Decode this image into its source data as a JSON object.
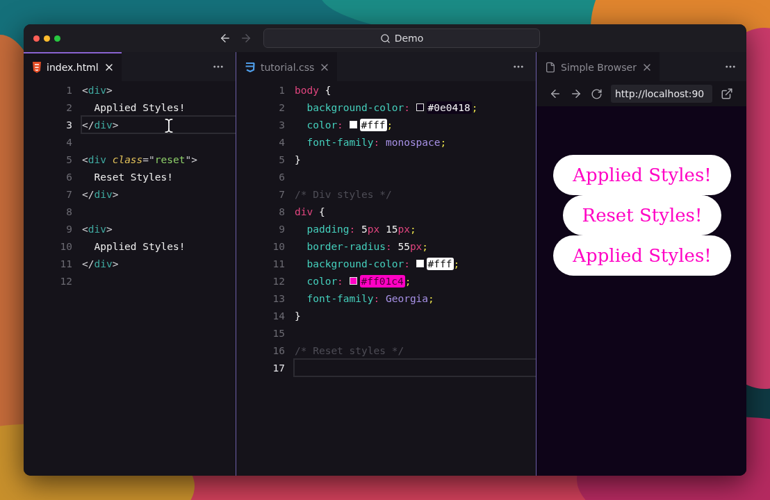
{
  "window": {
    "search": "Demo"
  },
  "panes": [
    {
      "kind": "code",
      "tab": {
        "label": "index.html",
        "selected": true
      },
      "lines": [
        {
          "number": "1",
          "current": false,
          "tokens": [
            {
              "kind": "bracket",
              "text": "<"
            },
            {
              "kind": "tag",
              "text": "div"
            },
            {
              "kind": "bracket",
              "text": ">"
            }
          ]
        },
        {
          "number": "2",
          "current": false,
          "tokens": [
            {
              "kind": "text",
              "text": "  Applied Styles!"
            }
          ]
        },
        {
          "number": "3",
          "current": true,
          "tokens": [
            {
              "kind": "bracket",
              "text": "</"
            },
            {
              "kind": "tag",
              "text": "div"
            },
            {
              "kind": "bracket",
              "text": ">"
            }
          ]
        },
        {
          "number": "4",
          "current": false
        },
        {
          "number": "5",
          "current": false,
          "tokens": [
            {
              "kind": "bracket",
              "text": "<"
            },
            {
              "kind": "tag",
              "text": "div"
            },
            {
              "kind": "attr",
              "text": " class"
            },
            {
              "kind": "punct",
              "text": "=\""
            },
            {
              "kind": "string",
              "text": "reset"
            },
            {
              "kind": "punct",
              "text": "\""
            },
            {
              "kind": "bracket",
              "text": ">"
            }
          ]
        },
        {
          "number": "6",
          "current": false,
          "tokens": [
            {
              "kind": "text",
              "text": "  Reset Styles!"
            }
          ]
        },
        {
          "number": "7",
          "current": false,
          "tokens": [
            {
              "kind": "bracket",
              "text": "</"
            },
            {
              "kind": "tag",
              "text": "div"
            },
            {
              "kind": "bracket",
              "text": ">"
            }
          ]
        },
        {
          "number": "8",
          "current": false
        },
        {
          "number": "9",
          "current": false,
          "tokens": [
            {
              "kind": "bracket",
              "text": "<"
            },
            {
              "kind": "tag",
              "text": "div"
            },
            {
              "kind": "bracket",
              "text": ">"
            }
          ]
        },
        {
          "number": "10",
          "current": false,
          "tokens": [
            {
              "kind": "text",
              "text": "  Applied Styles!"
            }
          ]
        },
        {
          "number": "11",
          "current": false,
          "tokens": [
            {
              "kind": "bracket",
              "text": "</"
            },
            {
              "kind": "tag",
              "text": "div"
            },
            {
              "kind": "bracket",
              "text": ">"
            }
          ]
        },
        {
          "number": "12",
          "current": false
        }
      ]
    },
    {
      "kind": "code",
      "tab": {
        "label": "tutorial.css",
        "selected": false
      },
      "lines": [
        {
          "number": "1",
          "current": false,
          "tokens": [
            {
              "kind": "selector",
              "text": "body"
            },
            {
              "kind": "brace",
              "text": " {"
            }
          ]
        },
        {
          "number": "2",
          "current": false,
          "tokens": [
            {
              "kind": "property",
              "text": "  background-color"
            },
            {
              "kind": "colon",
              "text": ": "
            },
            {
              "kind": "swatch",
              "color": "#0e0418"
            },
            {
              "kind": "hex",
              "text": "#0e0418",
              "color": "#0e0418"
            },
            {
              "kind": "semicolon",
              "text": ";"
            }
          ]
        },
        {
          "number": "3",
          "current": false,
          "tokens": [
            {
              "kind": "property",
              "text": "  color"
            },
            {
              "kind": "colon",
              "text": ": "
            },
            {
              "kind": "swatch",
              "color": "#ffffff"
            },
            {
              "kind": "hex",
              "text": "#fff",
              "color": "#ffffff"
            },
            {
              "kind": "semicolon",
              "text": ";"
            }
          ]
        },
        {
          "number": "4",
          "current": false,
          "tokens": [
            {
              "kind": "property",
              "text": "  font-family"
            },
            {
              "kind": "colon",
              "text": ": "
            },
            {
              "kind": "value",
              "text": "monospace"
            },
            {
              "kind": "semicolon",
              "text": ";"
            }
          ]
        },
        {
          "number": "5",
          "current": false,
          "tokens": [
            {
              "kind": "brace",
              "text": "}"
            }
          ]
        },
        {
          "number": "6",
          "current": false
        },
        {
          "number": "7",
          "current": false,
          "tokens": [
            {
              "kind": "comment",
              "text": "/* Div styles */"
            }
          ]
        },
        {
          "number": "8",
          "current": false,
          "tokens": [
            {
              "kind": "selector",
              "text": "div"
            },
            {
              "kind": "brace",
              "text": " {"
            }
          ]
        },
        {
          "number": "9",
          "current": false,
          "tokens": [
            {
              "kind": "property",
              "text": "  padding"
            },
            {
              "kind": "colon",
              "text": ": "
            },
            {
              "kind": "number",
              "text": "5"
            },
            {
              "kind": "unit",
              "text": "px"
            },
            {
              "kind": "number",
              "text": " 15"
            },
            {
              "kind": "unit",
              "text": "px"
            },
            {
              "kind": "semicolon",
              "text": ";"
            }
          ]
        },
        {
          "number": "10",
          "current": false,
          "tokens": [
            {
              "kind": "property",
              "text": "  border-radius"
            },
            {
              "kind": "colon",
              "text": ": "
            },
            {
              "kind": "number",
              "text": "55"
            },
            {
              "kind": "unit",
              "text": "px"
            },
            {
              "kind": "semicolon",
              "text": ";"
            }
          ]
        },
        {
          "number": "11",
          "current": false,
          "tokens": [
            {
              "kind": "property",
              "text": "  background-color"
            },
            {
              "kind": "colon",
              "text": ": "
            },
            {
              "kind": "swatch",
              "color": "#ffffff"
            },
            {
              "kind": "hex",
              "text": "#fff",
              "color": "#ffffff"
            },
            {
              "kind": "semicolon",
              "text": ";"
            }
          ]
        },
        {
          "number": "12",
          "current": false,
          "tokens": [
            {
              "kind": "property",
              "text": "  color"
            },
            {
              "kind": "colon",
              "text": ": "
            },
            {
              "kind": "swatch",
              "color": "#ff01c4"
            },
            {
              "kind": "hex",
              "text": "#ff01c4",
              "color": "#ff01c4"
            },
            {
              "kind": "semicolon",
              "text": ";"
            }
          ]
        },
        {
          "number": "13",
          "current": false,
          "tokens": [
            {
              "kind": "property",
              "text": "  font-family"
            },
            {
              "kind": "colon",
              "text": ": "
            },
            {
              "kind": "value",
              "text": "Georgia"
            },
            {
              "kind": "semicolon",
              "text": ";"
            }
          ]
        },
        {
          "number": "14",
          "current": false,
          "tokens": [
            {
              "kind": "brace",
              "text": "}"
            }
          ]
        },
        {
          "number": "15",
          "current": false
        },
        {
          "number": "16",
          "current": false,
          "tokens": [
            {
              "kind": "comment",
              "text": "/* Reset styles */"
            }
          ]
        },
        {
          "number": "17",
          "current": true
        }
      ]
    },
    {
      "kind": "browser",
      "tab": {
        "label": "Simple Browser",
        "selected": false
      },
      "url": "http://localhost:90",
      "items": [
        {
          "text": "Applied Styles!"
        },
        {
          "text": "Reset Styles!"
        },
        {
          "text": "Applied Styles!"
        }
      ]
    }
  ]
}
